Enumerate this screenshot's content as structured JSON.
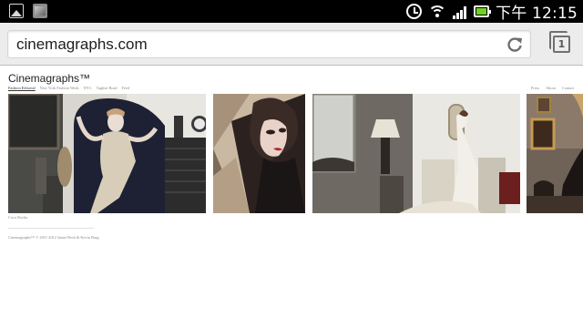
{
  "status_bar": {
    "left_icons": [
      "gallery-icon",
      "gallery-photo-icon"
    ],
    "right_icons": [
      "alarm-icon",
      "wifi-icon",
      "signal-icon",
      "battery-icon"
    ],
    "time": "下午 12:15",
    "battery_color": "#6fd21e"
  },
  "browser": {
    "url": "cinemagraphs.com",
    "reload_icon": "reload-icon",
    "tab_count": "1"
  },
  "site": {
    "title": "Cinemagraphs™",
    "nav": [
      {
        "label": "Fashion Editorial"
      },
      {
        "label": "New York Fashion Week"
      },
      {
        "label": "NYC"
      },
      {
        "label": "Tagline Road"
      },
      {
        "label": "Feed"
      }
    ],
    "nav_right": [
      {
        "label": "Press"
      },
      {
        "label": "About"
      },
      {
        "label": "Contact"
      }
    ],
    "photos": [
      {
        "subject": "woman in sequined gown seated in dark armchair"
      },
      {
        "subject": "woman with red lips reflected in mirror"
      },
      {
        "subject": "woman in white dress in vintage room"
      },
      {
        "subject": "interior with framed portrait"
      }
    ],
    "caption": "Coco Rocha",
    "copyright": "Cinemagraphs™ © 2011-2012 Jamie Beck & Kevin Burg"
  }
}
